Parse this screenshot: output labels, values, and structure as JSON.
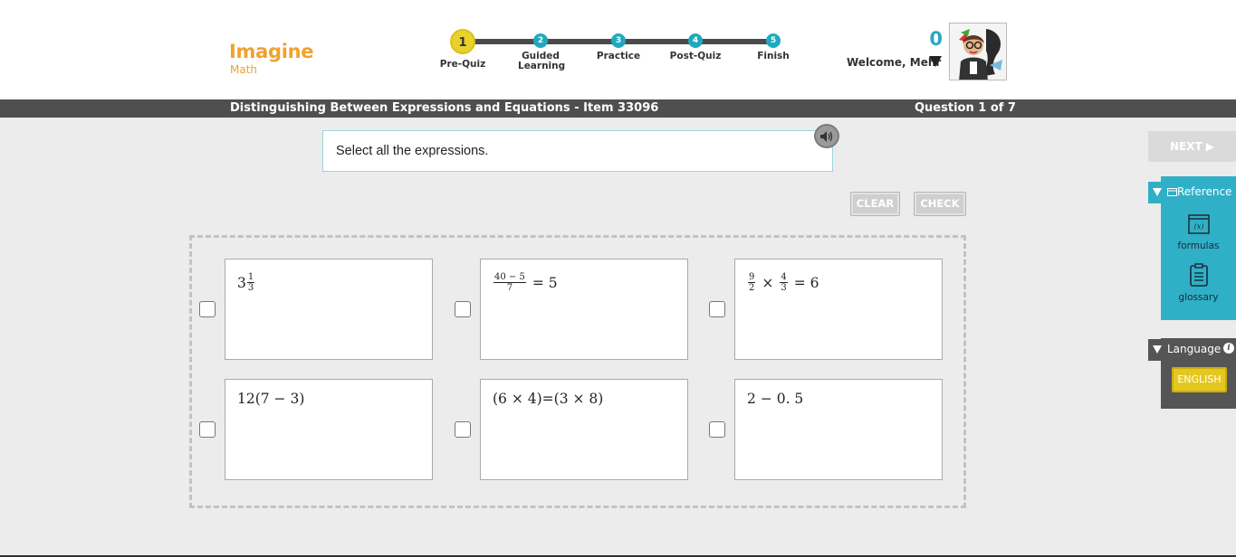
{
  "app": {
    "logo_line1": "Imagine",
    "logo_line2": "Math"
  },
  "progress": {
    "steps": [
      {
        "number": "1",
        "label": "Pre-Quiz"
      },
      {
        "number": "2",
        "label": "Guided Learning"
      },
      {
        "number": "3",
        "label": "Practice"
      },
      {
        "number": "4",
        "label": "Post-Quiz"
      },
      {
        "number": "5",
        "label": "Finish"
      }
    ],
    "current_step": 1
  },
  "user": {
    "score": "0",
    "welcome": "Welcome, Mehr"
  },
  "titlebar": {
    "lesson": "Distinguishing Between Expressions and Equations - Item 33096",
    "question": "Question 1 of 7"
  },
  "prompt": {
    "text": "Select all the expressions."
  },
  "controls": {
    "clear": "CLEAR",
    "check": "CHECK",
    "next": "NEXT ▶"
  },
  "answers": [
    {
      "id": "a1",
      "expr": "3 1/3",
      "checked": false
    },
    {
      "id": "a2",
      "expr": "(40 − 5)/7 = 5",
      "checked": false
    },
    {
      "id": "a3",
      "expr": "9/2 × 4/3 = 6",
      "checked": false
    },
    {
      "id": "a4",
      "expr": "12(7 − 3)",
      "checked": false
    },
    {
      "id": "a5",
      "expr": "(6 × 4)=(3 × 8)",
      "checked": false
    },
    {
      "id": "a6",
      "expr": "2 − 0.5",
      "checked": false
    }
  ],
  "math_parts": {
    "a1_whole": "3",
    "a1_num": "1",
    "a1_den": "3",
    "a2_num": "40 − 5",
    "a2_den": "7",
    "a2_rest": "= 5",
    "a3_n1": "9",
    "a3_d1": "2",
    "a3_times": "×",
    "a3_n2": "4",
    "a3_d2": "3",
    "a3_rest": "= 6",
    "a4": "12(7 − 3)",
    "a5": "(6 × 4)=(3 × 8)",
    "a6": "2 − 0. 5"
  },
  "sidebar": {
    "reference_label": "Reference",
    "tools": [
      {
        "label": "formulas",
        "icon": "formula-icon",
        "glyph": "(x)"
      },
      {
        "label": "glossary",
        "icon": "clipboard-icon"
      }
    ],
    "language_label": "Language",
    "language_info_glyph": "i",
    "language_value": "ENGLISH"
  },
  "colors": {
    "accent": "#1fa9bf",
    "brand": "#f0a22e",
    "active_step": "#e8d22a",
    "language_button": "#e5c81f"
  }
}
